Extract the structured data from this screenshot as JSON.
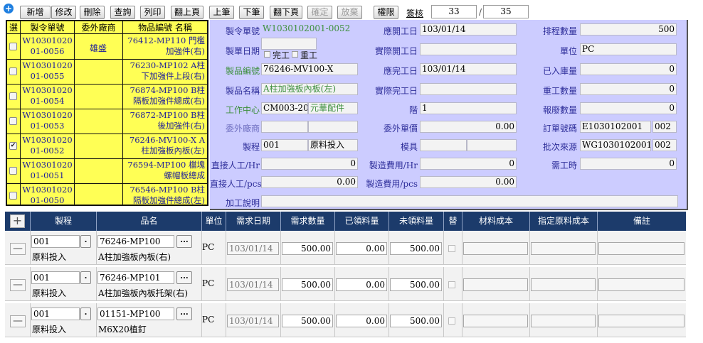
{
  "toolbar": {
    "buttons": [
      "新增",
      "修改",
      "刪除",
      "查詢",
      "列印",
      "翻上頁",
      "上筆",
      "下筆",
      "翻下頁",
      "確定",
      "放棄",
      "權限"
    ],
    "sign_label": "簽核",
    "current_page": "33",
    "total_pages": "35"
  },
  "order_list": {
    "headers": [
      "選",
      "製令單號",
      "委外廠商",
      "物品編號 名稱"
    ],
    "rows": [
      {
        "checked": false,
        "order": "W1030102001-0056",
        "vendor": "雄盛",
        "item": "76412-MP110 門檻加強件(右)"
      },
      {
        "checked": false,
        "order": "W1030102001-0055",
        "vendor": "",
        "item": "76230-MP102 A柱下加強件上段(右)"
      },
      {
        "checked": false,
        "order": "W1030102001-0054",
        "vendor": "",
        "item": "76874-MP100 B柱隔板加強件總成(右)"
      },
      {
        "checked": false,
        "order": "W1030102001-0053",
        "vendor": "",
        "item": "76872-MP100 B柱後加強件(右)"
      },
      {
        "checked": true,
        "order": "W1030102001-0052",
        "vendor": "",
        "item": "76246-MV100-X A柱加強板內板(左)"
      },
      {
        "checked": false,
        "order": "W1030102001-0051",
        "vendor": "",
        "item": "76594-MP100 檔塊螺帽板總成"
      },
      {
        "checked": false,
        "order": "W1030102001-0050",
        "vendor": "",
        "item": "76546-MP100 B柱隔板加強件總成(左)"
      }
    ]
  },
  "form": {
    "order_no_label": "製令單號",
    "order_no": "W1030102001-0052",
    "order_date_label": "製單日期",
    "order_date": "",
    "complete_label": "完工",
    "rework_label": "重工",
    "item_no_label": "製品編號",
    "item_no": "76246-MV100-X",
    "item_name_label": "製品名稱",
    "item_name": "A柱加強板內板(左)",
    "work_center_label": "工作中心",
    "work_center_code": "CM003-20",
    "work_center_name": "元華配件",
    "vendor_label": "委外廠商",
    "vendor_code": "",
    "vendor_name": "",
    "process_label": "製程",
    "process_code": "001",
    "process_name": "原料投入",
    "direct_labor_hr_label": "直接人工/Hr",
    "direct_labor_hr": "0",
    "direct_labor_pcs_label": "直接人工/pcs",
    "direct_labor_pcs": "0.00",
    "remark_label": "加工說明",
    "remark": "",
    "planned_start_label": "應開工日",
    "planned_start": "103/01/14",
    "actual_start_label": "實際開工日",
    "actual_start": "",
    "planned_finish_label": "應完工日",
    "planned_finish": "103/01/14",
    "actual_finish_label": "實際完工日",
    "actual_finish": "",
    "step_label": "階",
    "step": "1",
    "outsource_price_label": "委外單價",
    "outsource_price": "0.00",
    "mold_label": "模具",
    "mold_code": "",
    "mold_name": "",
    "mfg_cost_hr_label": "製造費用/Hr",
    "mfg_cost_hr": "0",
    "mfg_cost_pcs_label": "製造費用/pcs",
    "mfg_cost_pcs": "0.00",
    "scheduled_qty_label": "排程數量",
    "scheduled_qty": "500",
    "unit_label": "單位",
    "unit": "PC",
    "stocked_qty_label": "已入庫量",
    "stocked_qty": "0",
    "rework_qty_label": "重工數量",
    "rework_qty": "0",
    "scrap_qty_label": "報廢數量",
    "scrap_qty": "0",
    "sales_order_label": "訂單號碼",
    "sales_order": "E1030102001",
    "sales_order_seq": "002",
    "batch_source_label": "批次來源",
    "batch_source": "WG1030102001",
    "batch_source_seq": "002",
    "required_hours_label": "需工時",
    "required_hours": "0"
  },
  "materials": {
    "headers": [
      "製程",
      "品名",
      "單位",
      "需求日期",
      "需求數量",
      "已領料量",
      "未領料量",
      "替",
      "材料成本",
      "指定原料成本",
      "備註"
    ],
    "rows": [
      {
        "process_code": "001",
        "process_name": "原料投入",
        "item_code": "76246-MP100",
        "item_name": "A柱加強板內板(右)",
        "unit": "PC",
        "date": "103/01/14",
        "req_qty": "500.00",
        "issued_qty": "0.00",
        "unissued_qty": "500.00"
      },
      {
        "process_code": "001",
        "process_name": "原料投入",
        "item_code": "76246-MP101",
        "item_name": "A柱加強板內板托架(右)",
        "unit": "PC",
        "date": "103/01/14",
        "req_qty": "500.00",
        "issued_qty": "0.00",
        "unissued_qty": "500.00"
      },
      {
        "process_code": "001",
        "process_name": "原料投入",
        "item_code": "01151-MP100",
        "item_name": "M6X20植釘",
        "unit": "PC",
        "date": "103/01/14",
        "req_qty": "500.00",
        "issued_qty": "0.00",
        "unissued_qty": "500.00"
      }
    ],
    "dot_label": ".",
    "ellipsis_label": "...",
    "plus_label": "+",
    "minus_label": "—"
  }
}
